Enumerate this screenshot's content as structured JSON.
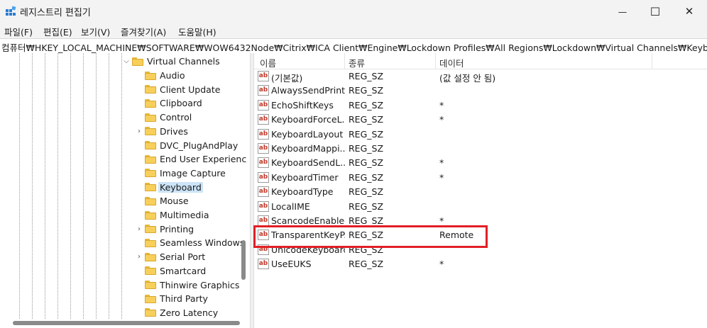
{
  "window": {
    "title": "레지스트리 편집기",
    "controls": {
      "minimize": "—",
      "maximize": "☐",
      "close": "✕"
    }
  },
  "menu": [
    "파일(F)",
    "편집(E)",
    "보기(V)",
    "즐겨찾기(A)",
    "도움말(H)"
  ],
  "address": "컴퓨터₩HKEY_LOCAL_MACHINE₩SOFTWARE₩WOW6432Node₩Citrix₩ICA Client₩Engine₩Lockdown Profiles₩All Regions₩Lockdown₩Virtual Channels₩Keyboard",
  "tree": {
    "parent": {
      "label": "Virtual Channels",
      "expanded": true
    },
    "children": [
      {
        "label": "Audio",
        "has_children": false
      },
      {
        "label": "Client Update",
        "has_children": false
      },
      {
        "label": "Clipboard",
        "has_children": false
      },
      {
        "label": "Control",
        "has_children": false
      },
      {
        "label": "Drives",
        "has_children": true
      },
      {
        "label": "DVC_PlugAndPlay",
        "has_children": false
      },
      {
        "label": "End User Experienc",
        "has_children": false
      },
      {
        "label": "Image Capture",
        "has_children": false
      },
      {
        "label": "Keyboard",
        "has_children": false,
        "selected": true
      },
      {
        "label": "Mouse",
        "has_children": false
      },
      {
        "label": "Multimedia",
        "has_children": false
      },
      {
        "label": "Printing",
        "has_children": true
      },
      {
        "label": "Seamless Windows",
        "has_children": false
      },
      {
        "label": "Serial Port",
        "has_children": true
      },
      {
        "label": "Smartcard",
        "has_children": false
      },
      {
        "label": "Thinwire Graphics",
        "has_children": false
      },
      {
        "label": "Third Party",
        "has_children": false
      },
      {
        "label": "Zero Latency",
        "has_children": false
      }
    ]
  },
  "list": {
    "columns": [
      "이름",
      "종류",
      "데이터"
    ],
    "rows": [
      {
        "name": "(기본값)",
        "type": "REG_SZ",
        "data": "(값 설정 안 됨)"
      },
      {
        "name": "AlwaysSendPrint...",
        "type": "REG_SZ",
        "data": ""
      },
      {
        "name": "EchoShiftKeys",
        "type": "REG_SZ",
        "data": "*"
      },
      {
        "name": "KeyboardForceL...",
        "type": "REG_SZ",
        "data": "*"
      },
      {
        "name": "KeyboardLayout",
        "type": "REG_SZ",
        "data": ""
      },
      {
        "name": "KeyboardMappi...",
        "type": "REG_SZ",
        "data": ""
      },
      {
        "name": "KeyboardSendL...",
        "type": "REG_SZ",
        "data": "*"
      },
      {
        "name": "KeyboardTimer",
        "type": "REG_SZ",
        "data": "*"
      },
      {
        "name": "KeyboardType",
        "type": "REG_SZ",
        "data": ""
      },
      {
        "name": "LocalIME",
        "type": "REG_SZ",
        "data": ""
      },
      {
        "name": "ScancodeEnabled",
        "type": "REG_SZ",
        "data": "*"
      },
      {
        "name": "TransparentKeyP...",
        "type": "REG_SZ",
        "data": "Remote",
        "highlighted": true
      },
      {
        "name": "UnicodeKeyboard",
        "type": "REG_SZ",
        "data": ""
      },
      {
        "name": "UseEUKS",
        "type": "REG_SZ",
        "data": "*"
      }
    ],
    "value_icon": "ab"
  },
  "colors": {
    "selection": "#cce4f7",
    "highlight_box": "#e21f26",
    "folder": "#f7cf5a"
  }
}
